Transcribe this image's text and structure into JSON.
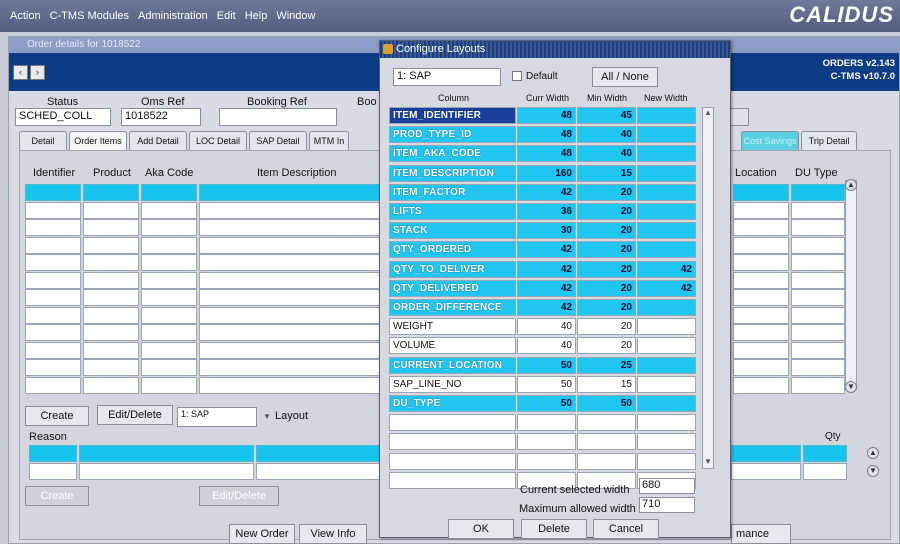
{
  "menu": [
    "Action",
    "C-TMS Modules",
    "Administration",
    "Edit",
    "Help",
    "Window"
  ],
  "brand": "CALIDUS",
  "window": {
    "title": "Order details for 1018522",
    "version_line1": "ORDERS v2.143",
    "version_line2": "C-TMS v10.7.0"
  },
  "fields": {
    "status_label": "Status",
    "status_value": "SCHED_COLL",
    "oms_label": "Oms Ref",
    "oms_value": "1018522",
    "booking_label": "Booking Ref",
    "boo_label": "Boo"
  },
  "tabs": [
    "Detail",
    "Order Items",
    "Add Detail",
    "LOC Detail",
    "SAP Detail",
    "MTM In",
    "Cost Savings",
    "Trip Detail"
  ],
  "columns": {
    "identifier": "Identifier",
    "product": "Product",
    "aka": "Aka Code",
    "desc": "Item Description",
    "location": "Location",
    "du_type": "DU Type"
  },
  "bottom": {
    "create": "Create",
    "edit_delete": "Edit/Delete",
    "layout_value": "1: SAP",
    "layout_label": "Layout",
    "reason_label": "Reason",
    "qty_label": "Qty",
    "create2": "Create",
    "edit_delete2": "Edit/Delete",
    "new_order": "New Order",
    "view_info": "View Info",
    "performance_partial": "mance"
  },
  "dialog": {
    "title": "Configure Layouts",
    "layout_name": "1: SAP",
    "default_label": "Default",
    "all_none": "All / None",
    "headers": {
      "column": "Column",
      "curr": "Curr Width",
      "min": "Min Width",
      "new": "New Width"
    },
    "rows": [
      {
        "name": "ITEM_IDENTIFIER",
        "curr": "48",
        "min": "45",
        "new": "",
        "hl": true
      },
      {
        "name": "PROD_TYPE_ID",
        "curr": "48",
        "min": "40",
        "new": "",
        "hl": true
      },
      {
        "name": "ITEM_AKA_CODE",
        "curr": "48",
        "min": "40",
        "new": "",
        "hl": true
      },
      {
        "name": "ITEM_DESCRIPTION",
        "curr": "160",
        "min": "15",
        "new": "",
        "hl": true
      },
      {
        "name": "ITEM_FACTOR",
        "curr": "42",
        "min": "20",
        "new": "",
        "hl": true
      },
      {
        "name": "LIFTS",
        "curr": "36",
        "min": "20",
        "new": "",
        "hl": true
      },
      {
        "name": "STACK",
        "curr": "30",
        "min": "20",
        "new": "",
        "hl": true
      },
      {
        "name": "QTY_ORDERED",
        "curr": "42",
        "min": "20",
        "new": "",
        "hl": true
      },
      {
        "name": "QTY_TO_DELIVER",
        "curr": "42",
        "min": "20",
        "new": "42",
        "hl": true
      },
      {
        "name": "QTY_DELIVERED",
        "curr": "42",
        "min": "20",
        "new": "42",
        "hl": true
      },
      {
        "name": "ORDER_DIFFERENCE",
        "curr": "42",
        "min": "20",
        "new": "",
        "hl": true
      },
      {
        "name": "WEIGHT",
        "curr": "40",
        "min": "20",
        "new": "",
        "hl": false
      },
      {
        "name": "VOLUME",
        "curr": "40",
        "min": "20",
        "new": "",
        "hl": false
      },
      {
        "name": "CURRENT_LOCATION",
        "curr": "50",
        "min": "25",
        "new": "",
        "hl": true
      },
      {
        "name": "SAP_LINE_NO",
        "curr": "50",
        "min": "15",
        "new": "",
        "hl": false
      },
      {
        "name": "DU_TYPE",
        "curr": "50",
        "min": "50",
        "new": "",
        "hl": true
      }
    ],
    "current_width_label": "Current selected width",
    "current_width": "680",
    "max_width_label": "Maximum allowed width",
    "max_width": "710",
    "ok": "OK",
    "delete": "Delete",
    "cancel": "Cancel"
  },
  "colors": {
    "highlight": "#20c6f0",
    "navbar": "#0c3c86",
    "titlebar": "#1e3e7c"
  }
}
